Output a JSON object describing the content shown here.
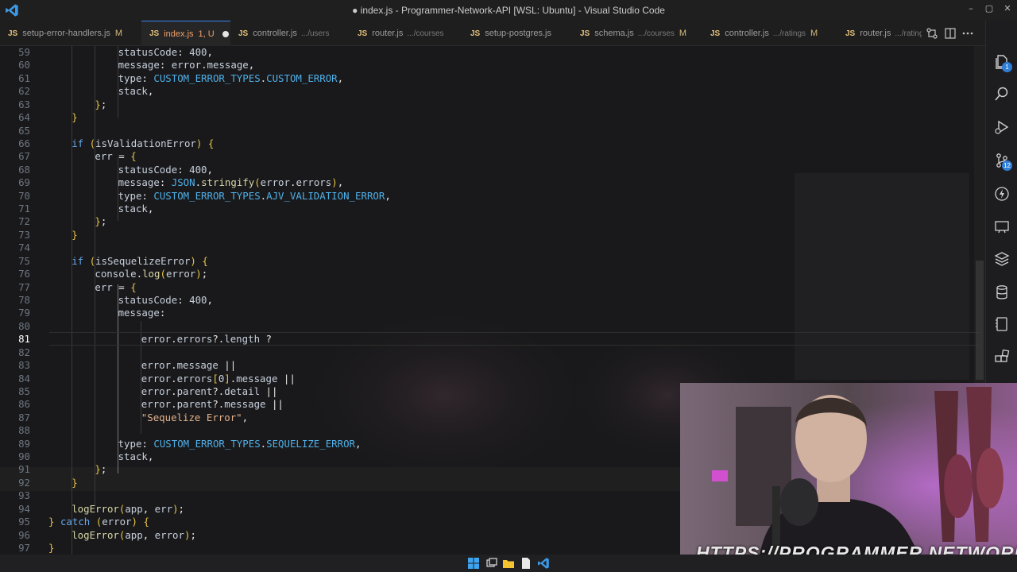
{
  "window": {
    "title": "● index.js - Programmer-Network-API [WSL: Ubuntu] - Visual Studio Code",
    "controls": [
      "–",
      "▢",
      "✕"
    ]
  },
  "tabs": [
    {
      "name": "setup-error-handlers.js",
      "dir": "",
      "mod": "M",
      "active": false
    },
    {
      "name": "index.js",
      "dir": "",
      "mod": "1, U",
      "active": true,
      "dirty": true
    },
    {
      "name": "controller.js",
      "dir": ".../users",
      "mod": "",
      "active": false
    },
    {
      "name": "router.js",
      "dir": ".../courses",
      "mod": "",
      "active": false
    },
    {
      "name": "setup-postgres.js",
      "dir": "",
      "mod": "",
      "active": false
    },
    {
      "name": "schema.js",
      "dir": ".../courses",
      "mod": "M",
      "active": false
    },
    {
      "name": "controller.js",
      "dir": ".../ratings",
      "mod": "M",
      "active": false
    },
    {
      "name": "router.js",
      "dir": ".../ratings",
      "mod": "",
      "active": false
    }
  ],
  "tab_file_icon": "JS",
  "tab_actions": [
    "compare-changes-icon",
    "split-editor-icon",
    "more-actions-icon"
  ],
  "editor": {
    "current_line": 81,
    "lines": [
      {
        "no": 59,
        "indent": 4,
        "code": "statusCode: 400,"
      },
      {
        "no": 60,
        "indent": 4,
        "code": "message: error.message,"
      },
      {
        "no": 61,
        "indent": 4,
        "code": "type: CUSTOM_ERROR_TYPES.CUSTOM_ERROR,"
      },
      {
        "no": 62,
        "indent": 4,
        "code": "stack,"
      },
      {
        "no": 63,
        "indent": 3,
        "code": "};"
      },
      {
        "no": 64,
        "indent": 2,
        "code": "}"
      },
      {
        "no": 65,
        "indent": 0,
        "code": ""
      },
      {
        "no": 66,
        "indent": 2,
        "code": "if (isValidationError) {"
      },
      {
        "no": 67,
        "indent": 3,
        "code": "err = {"
      },
      {
        "no": 68,
        "indent": 4,
        "code": "statusCode: 400,"
      },
      {
        "no": 69,
        "indent": 4,
        "code": "message: JSON.stringify(error.errors),"
      },
      {
        "no": 70,
        "indent": 4,
        "code": "type: CUSTOM_ERROR_TYPES.AJV_VALIDATION_ERROR,"
      },
      {
        "no": 71,
        "indent": 4,
        "code": "stack,"
      },
      {
        "no": 72,
        "indent": 3,
        "code": "};"
      },
      {
        "no": 73,
        "indent": 2,
        "code": "}"
      },
      {
        "no": 74,
        "indent": 0,
        "code": ""
      },
      {
        "no": 75,
        "indent": 2,
        "code": "if (isSequelizeError) {"
      },
      {
        "no": 76,
        "indent": 3,
        "code": "console.log(error);"
      },
      {
        "no": 77,
        "indent": 3,
        "code": "err = {"
      },
      {
        "no": 78,
        "indent": 4,
        "code": "statusCode: 400,"
      },
      {
        "no": 79,
        "indent": 4,
        "code": "message:"
      },
      {
        "no": 80,
        "indent": 0,
        "code": ""
      },
      {
        "no": 81,
        "indent": 5,
        "code": "error.errors?.length ?"
      },
      {
        "no": 82,
        "indent": 0,
        "code": ""
      },
      {
        "no": 83,
        "indent": 5,
        "code": "error.message ||"
      },
      {
        "no": 84,
        "indent": 5,
        "code": "error.errors[0].message ||"
      },
      {
        "no": 85,
        "indent": 5,
        "code": "error.parent?.detail ||"
      },
      {
        "no": 86,
        "indent": 5,
        "code": "error.parent?.message ||"
      },
      {
        "no": 87,
        "indent": 5,
        "code": "\"Sequelize Error\","
      },
      {
        "no": 88,
        "indent": 0,
        "code": ""
      },
      {
        "no": 89,
        "indent": 4,
        "code": "type: CUSTOM_ERROR_TYPES.SEQUELIZE_ERROR,"
      },
      {
        "no": 90,
        "indent": 4,
        "code": "stack,"
      },
      {
        "no": 91,
        "indent": 3,
        "code": "};"
      },
      {
        "no": 92,
        "indent": 2,
        "code": "}"
      },
      {
        "no": 93,
        "indent": 0,
        "code": ""
      },
      {
        "no": 94,
        "indent": 2,
        "code": "logError(app, err);"
      },
      {
        "no": 95,
        "indent": 1,
        "code": "} catch (error) {"
      },
      {
        "no": 96,
        "indent": 2,
        "code": "logError(app, error);"
      },
      {
        "no": 97,
        "indent": 1,
        "code": "}"
      }
    ]
  },
  "activity_bar": [
    {
      "icon": "explorer-icon",
      "badge": "1"
    },
    {
      "icon": "search-icon",
      "badge": ""
    },
    {
      "icon": "run-debug-icon",
      "badge": ""
    },
    {
      "icon": "source-control-icon",
      "badge": "12"
    },
    {
      "icon": "lightning-icon",
      "badge": ""
    },
    {
      "icon": "remote-explorer-icon",
      "badge": ""
    },
    {
      "icon": "layers-icon",
      "badge": ""
    },
    {
      "icon": "database-icon",
      "badge": ""
    },
    {
      "icon": "notebook-icon",
      "badge": ""
    },
    {
      "icon": "extensions-icon",
      "badge": ""
    }
  ],
  "overlay": {
    "watermark": "HTTPS://PROGRAMMER.NETWORK"
  },
  "taskbar": [
    "start-icon",
    "task-view-icon",
    "file-explorer-icon",
    "notepad-icon",
    "vscode-icon"
  ]
}
